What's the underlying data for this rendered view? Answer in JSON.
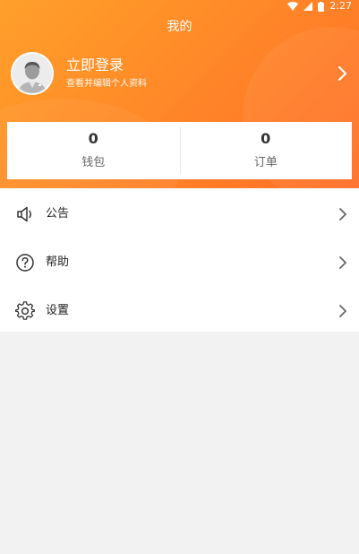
{
  "status_bar": {
    "time": "2:27"
  },
  "header": {
    "title": "我的"
  },
  "profile": {
    "login_title": "立即登录",
    "login_subtitle": "查看并编辑个人资料"
  },
  "stats": [
    {
      "value": "0",
      "label": "钱包"
    },
    {
      "value": "0",
      "label": "订单"
    }
  ],
  "menu": [
    {
      "label": "公告",
      "icon": "speaker-icon"
    },
    {
      "label": "帮助",
      "icon": "question-circle-icon"
    },
    {
      "label": "设置",
      "icon": "gear-icon"
    }
  ],
  "colors": {
    "header_gradient_start": "#ffa02a",
    "header_gradient_end": "#ff6d26",
    "background": "#f2f2f2"
  }
}
